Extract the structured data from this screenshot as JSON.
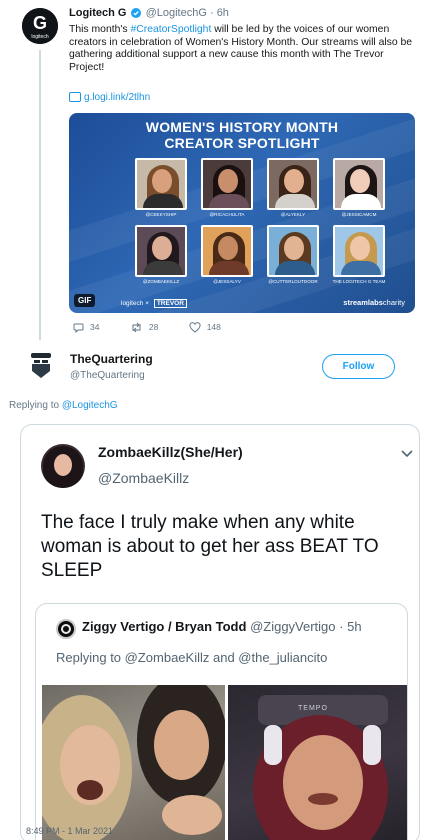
{
  "tweet1": {
    "display_name": "Logitech G",
    "handle": "@LogitechG",
    "time": "6h",
    "text_before": "This month's ",
    "hashtag": "#CreatorSpotlight",
    "text_after": " will be led by the voices of our women creators in celebration of Women's History Month. Our streams will also be gathering additional support a new cause this month with The  Trevor Project!",
    "link": "g.logi.link/2tlhn",
    "avatar_label": "logitech",
    "media": {
      "title_line1": "WOMEN'S HISTORY MONTH",
      "title_line2": "CREATOR SPOTLIGHT",
      "handles_row1": [
        "@CEEKYSHIP",
        "@RICACHULITA",
        "@ALYEKLY",
        "@JESSICAMCM"
      ],
      "handles_row2": [
        "@ZOMBAEKILLZ",
        "@JESSALYV",
        "@CUTTERLOUTDOOR",
        "THE LOGITECH G TEAM"
      ],
      "gif_label": "GIF",
      "footer_brand": "logitech",
      "footer_x": "×",
      "footer_partner": "TREVOR",
      "footer_right_bold": "streamlabs",
      "footer_right": "charity"
    },
    "replies": "34",
    "retweets": "28",
    "likes": "148"
  },
  "tweet2": {
    "display_name": "TheQuartering",
    "handle": "@TheQuartering",
    "follow_label": "Follow",
    "replying_prefix": "Replying to ",
    "replying_to": "@LogitechG"
  },
  "quoted": {
    "display_name": "ZombaeKillz(She/Her)",
    "handle": "@ZombaeKillz",
    "text": "The face I truly make when any white woman is about to get her ass BEAT TO SLEEP",
    "inner": {
      "display_name": "Ziggy Vertigo / Bryan Todd",
      "handle": "@ZiggyVertigo",
      "time": "5h",
      "replying": "Replying to @ZombaeKillz and @the_juliancito",
      "chair_label": "TEMPO"
    }
  },
  "timestamp": "8:49 PM - 1 Mar 2021",
  "colors": {
    "link": "#1b95e0",
    "follow": "#1da1f2",
    "muted": "#657786",
    "media_bg": "#2e68b5"
  }
}
